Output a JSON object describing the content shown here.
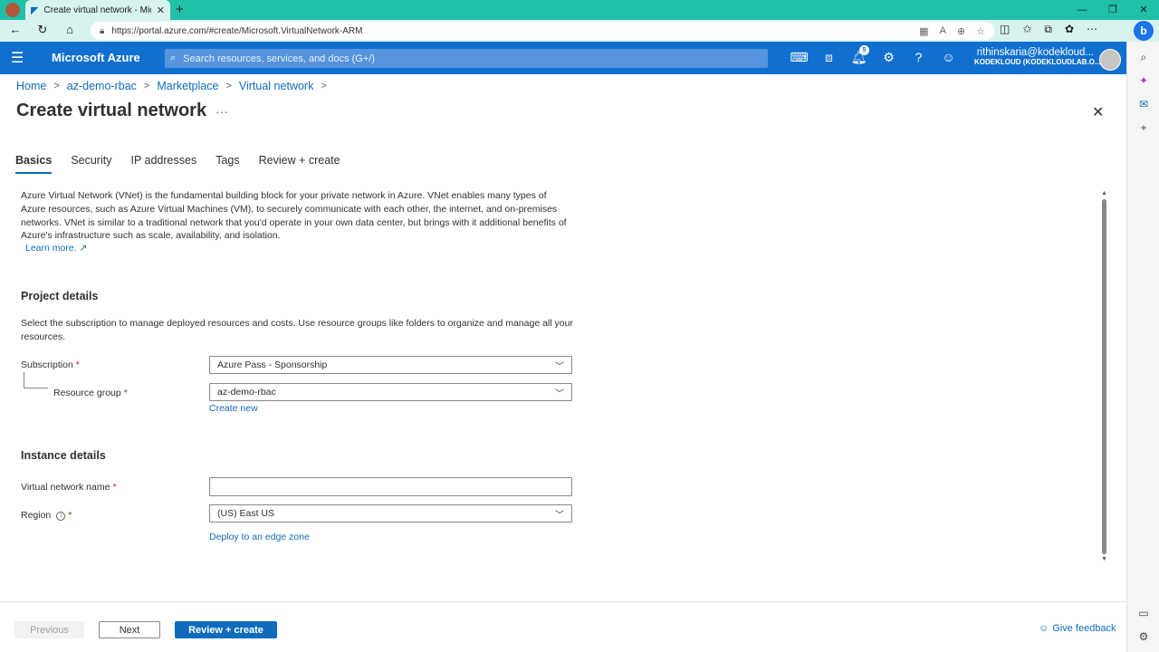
{
  "browser": {
    "tab_title": "Create virtual network - Microsoft Azure",
    "url": "https://portal.azure.com/#create/Microsoft.VirtualNetwork-ARM"
  },
  "header": {
    "brand": "Microsoft Azure",
    "search_placeholder": "Search resources, services, and docs (G+/)",
    "notification_count": "5",
    "user_email": "rithinskaria@kodekloud...",
    "tenant": "KODEKLOUD (KODEKLOUDLAB.O..."
  },
  "breadcrumb": [
    "Home",
    "az-demo-rbac",
    "Marketplace",
    "Virtual network"
  ],
  "page": {
    "title": "Create virtual network",
    "more": "···"
  },
  "tabs": [
    "Basics",
    "Security",
    "IP addresses",
    "Tags",
    "Review + create"
  ],
  "intro": {
    "text": "Azure Virtual Network (VNet) is the fundamental building block for your private network in Azure. VNet enables many types of Azure resources, such as Azure Virtual Machines (VM), to securely communicate with each other, the internet, and on-premises networks. VNet is similar to a traditional network that you'd operate in your own data center, but brings with it additional benefits of Azure's infrastructure such as scale, availability, and isolation.",
    "learn_more": "Learn more. ↗"
  },
  "project_details": {
    "title": "Project details",
    "description": "Select the subscription to manage deployed resources and costs. Use resource groups like folders to organize and manage all your resources.",
    "subscription_label": "Subscription",
    "subscription_value": "Azure Pass - Sponsorship",
    "resource_group_label": "Resource group",
    "resource_group_value": "az-demo-rbac",
    "create_new": "Create new"
  },
  "instance_details": {
    "title": "Instance details",
    "vnet_name_label": "Virtual network name",
    "vnet_name_value": "",
    "region_label": "Region",
    "region_value": "(US) East US",
    "edge_zone_link": "Deploy to an edge zone"
  },
  "footer": {
    "previous": "Previous",
    "next": "Next",
    "review_create": "Review + create",
    "feedback": "Give feedback"
  },
  "colors": {
    "azure_header": "#1170cf",
    "link": "#0f6cbd",
    "browser_chrome": "#20c0a8",
    "required": "#a4262c"
  }
}
